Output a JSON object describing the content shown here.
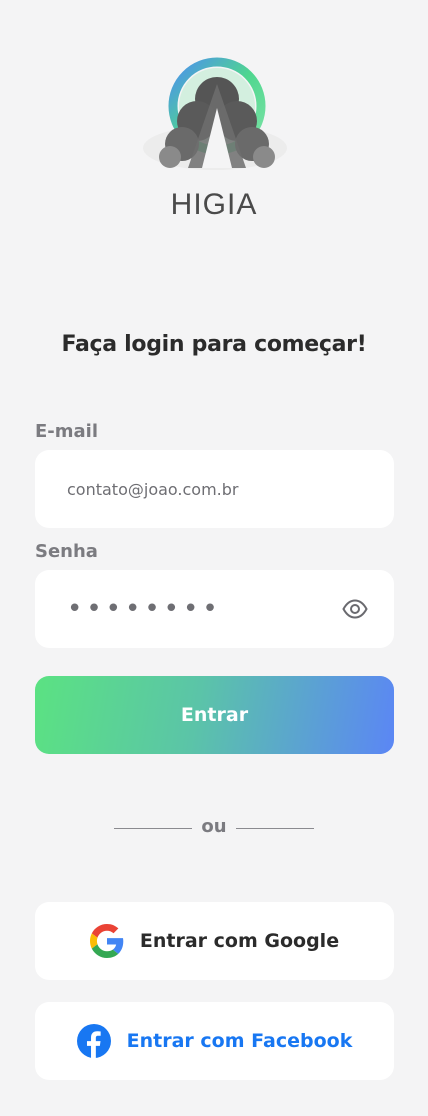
{
  "app": {
    "brand": "HIGIA"
  },
  "login": {
    "title": "Faça login para começar!",
    "email_label": "E-mail",
    "email_value": "contato@joao.com.br",
    "password_label": "Senha",
    "password_mask": "••••••••",
    "submit_label": "Entrar",
    "divider_label": "ou",
    "google_label": "Entrar com Google",
    "facebook_label": "Entrar com Facebook"
  },
  "colors": {
    "gradient_start": "#5be282",
    "gradient_end": "#5b86f5",
    "facebook_blue": "#1877f2",
    "background": "#f4f4f5"
  },
  "icons": [
    "logo-icon",
    "eye-icon",
    "google-icon",
    "facebook-icon"
  ]
}
